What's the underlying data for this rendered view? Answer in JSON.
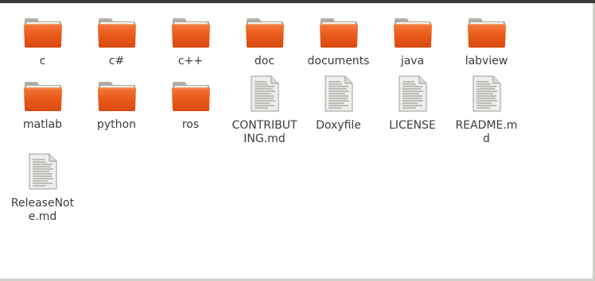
{
  "colors": {
    "window_top": "#3c3b37",
    "background": "#ffffff",
    "label_text": "#3c3c3c",
    "folder_front": "#e95b1a",
    "folder_back": "#c54613",
    "folder_paper": "#f6f4ef",
    "file_page": "#eeeeec"
  },
  "files": [
    {
      "name": "c",
      "kind": "folder",
      "icon": "folder-icon"
    },
    {
      "name": "c#",
      "kind": "folder",
      "icon": "folder-icon"
    },
    {
      "name": "c++",
      "kind": "folder",
      "icon": "folder-icon"
    },
    {
      "name": "doc",
      "kind": "folder",
      "icon": "folder-icon"
    },
    {
      "name": "documents",
      "kind": "folder",
      "icon": "folder-icon"
    },
    {
      "name": "java",
      "kind": "folder",
      "icon": "folder-icon"
    },
    {
      "name": "labview",
      "kind": "folder",
      "icon": "folder-icon"
    },
    {
      "name": "matlab",
      "kind": "folder",
      "icon": "folder-icon"
    },
    {
      "name": "python",
      "kind": "folder",
      "icon": "folder-icon"
    },
    {
      "name": "ros",
      "kind": "folder",
      "icon": "folder-icon"
    },
    {
      "name": "CONTRIBUTING.md",
      "kind": "file",
      "icon": "text-file-icon"
    },
    {
      "name": "Doxyfile",
      "kind": "file",
      "icon": "text-file-icon"
    },
    {
      "name": "LICENSE",
      "kind": "file",
      "icon": "text-file-icon"
    },
    {
      "name": "README.md",
      "kind": "file",
      "icon": "text-file-icon"
    },
    {
      "name": "ReleaseNote.md",
      "kind": "file",
      "icon": "text-file-icon"
    }
  ]
}
